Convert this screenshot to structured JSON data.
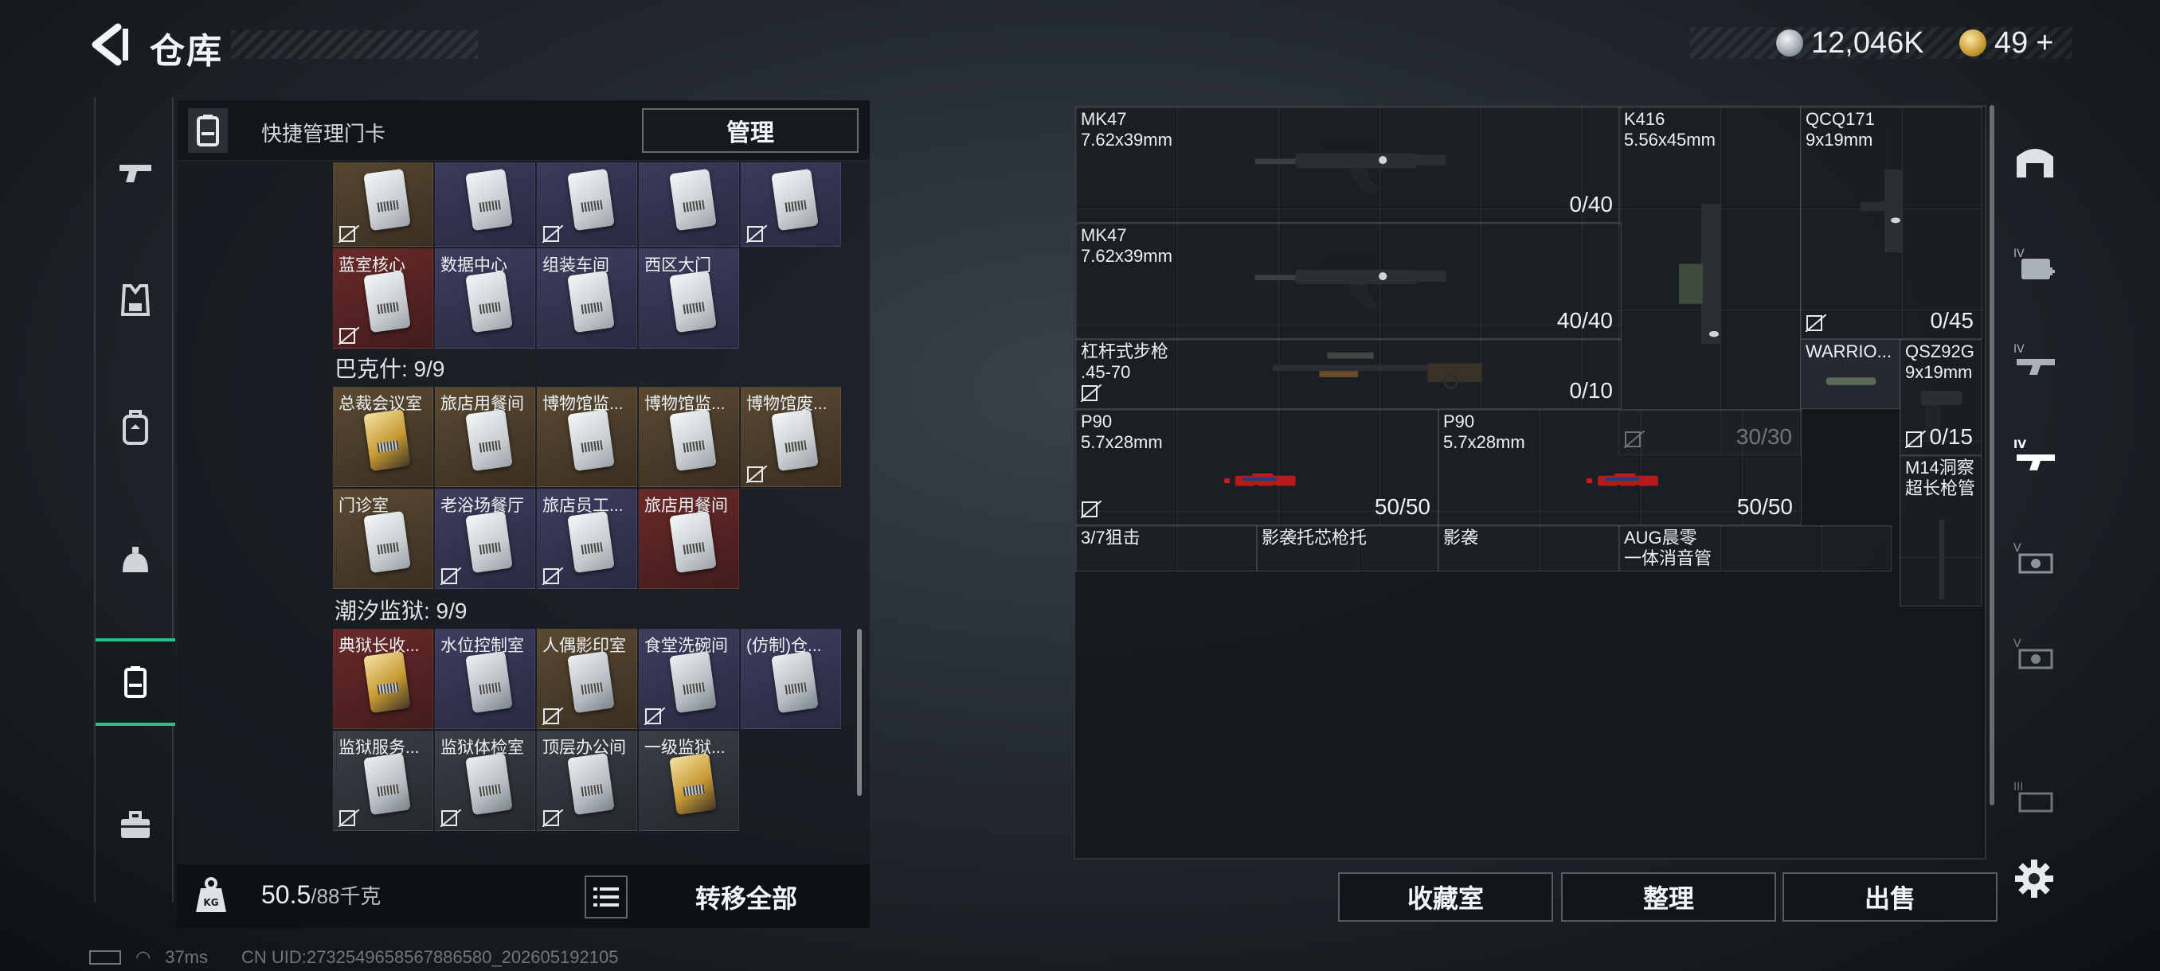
{
  "header": {
    "title": "仓库",
    "silver_amount": "12,046K",
    "gold_amount": "49",
    "gold_plus": "+"
  },
  "left_nav": {
    "items": [
      "firearm-icon",
      "armor-vest-icon",
      "backpack-icon",
      "helmet-bag-icon",
      "keycard-icon",
      "toolbox-icon"
    ],
    "active": "keycard-icon"
  },
  "keycard_panel": {
    "title": "快捷管理门卡",
    "manage_label": "管理",
    "top_row": [
      {
        "label": "",
        "color": "brown",
        "locked": true
      },
      {
        "label": "",
        "color": "purple",
        "locked": false
      },
      {
        "label": "",
        "color": "purple",
        "locked": true
      },
      {
        "label": "",
        "color": "purple",
        "locked": false
      },
      {
        "label": "",
        "color": "purple",
        "locked": true
      }
    ],
    "top_row2": [
      {
        "label": "蓝室核心",
        "color": "red",
        "locked": true
      },
      {
        "label": "数据中心",
        "color": "purple",
        "locked": false
      },
      {
        "label": "组装车间",
        "color": "purple",
        "locked": false
      },
      {
        "label": "西区大门",
        "color": "purple",
        "locked": false
      }
    ],
    "sections": [
      {
        "title": "巴克什: 9/9",
        "cards": [
          {
            "label": "总裁会议室",
            "color": "brown",
            "card": "gold",
            "locked": false
          },
          {
            "label": "旅店用餐间",
            "color": "brown",
            "card": "white",
            "locked": false
          },
          {
            "label": "博物馆监...",
            "color": "brown",
            "card": "white",
            "locked": false
          },
          {
            "label": "博物馆监...",
            "color": "brown",
            "card": "white",
            "locked": false
          },
          {
            "label": "博物馆废...",
            "color": "brown",
            "card": "white",
            "locked": true
          },
          {
            "label": "门诊室",
            "color": "brown",
            "card": "white",
            "locked": false
          },
          {
            "label": "老浴场餐厅",
            "color": "purple",
            "card": "white",
            "locked": true
          },
          {
            "label": "旅店员工...",
            "color": "purple",
            "card": "white",
            "locked": true
          },
          {
            "label": "旅店用餐间",
            "color": "red",
            "card": "white",
            "locked": false
          }
        ]
      },
      {
        "title": "潮汐监狱: 9/9",
        "cards": [
          {
            "label": "典狱长收...",
            "color": "red",
            "card": "gold",
            "locked": false
          },
          {
            "label": "水位控制室",
            "color": "purple",
            "card": "gray",
            "locked": false
          },
          {
            "label": "人偶影印室",
            "color": "brown",
            "card": "gray",
            "locked": true
          },
          {
            "label": "食堂洗碗间",
            "color": "purple",
            "card": "gray",
            "locked": true
          },
          {
            "label": "(仿制)仓...",
            "color": "purple",
            "card": "gray",
            "locked": false
          },
          {
            "label": "监狱服务...",
            "color": "dark",
            "card": "gray",
            "locked": true
          },
          {
            "label": "监狱体检室",
            "color": "dark",
            "card": "gray",
            "locked": true
          },
          {
            "label": "顶层办公间",
            "color": "dark",
            "card": "gray",
            "locked": true
          },
          {
            "label": "一级监狱...",
            "color": "dark",
            "card": "gold",
            "locked": false
          }
        ]
      }
    ]
  },
  "weight": {
    "current": "50.5",
    "capacity": "/88千克"
  },
  "transfer_all_label": "转移全部",
  "footer": {
    "ping": "37ms",
    "uid": "CN UID:2732549658567886580_202605192105"
  },
  "weapons": [
    {
      "name": "MK47\n7.62x39mm",
      "count": "0/40",
      "locked": false
    },
    {
      "name": "K416\n5.56x45mm",
      "count": "30/30",
      "locked": true
    },
    {
      "name": "QCQ171\n9x19mm",
      "count": "0/45",
      "locked": true
    },
    {
      "name": "MK47\n7.62x39mm",
      "count": "40/40",
      "locked": false
    },
    {
      "name": "杠杆式步枪\n.45-70",
      "count": "0/10",
      "locked": true
    },
    {
      "name": "WARRIO...",
      "count": "",
      "locked": false
    },
    {
      "name": "QSZ92G\n9x19mm",
      "count": "0/15",
      "locked": true
    },
    {
      "name": "P90\n5.7x28mm",
      "count": "50/50",
      "locked": true
    },
    {
      "name": "P90\n5.7x28mm",
      "count": "50/50",
      "locked": false
    },
    {
      "name": "M14洞察\n超长枪管",
      "count": "",
      "locked": false
    },
    {
      "name": "3/7狙击",
      "count": "",
      "locked": false
    },
    {
      "name": "影袭托芯枪托",
      "count": "",
      "locked": false
    },
    {
      "name": "影袭",
      "count": "",
      "locked": false
    },
    {
      "name": "AUG晨零\n一体消音管",
      "count": "",
      "locked": false
    }
  ],
  "bottom_buttons": {
    "collection": "收藏室",
    "organize": "整理",
    "sell": "出售"
  },
  "right_nav": {
    "items": [
      "bunker-icon",
      "medkit-iv-icon",
      "armor-iv-icon",
      "weapon-iv-icon",
      "weapon-v-icon",
      "weapon-v2-icon",
      "weapon-iii-icon"
    ]
  },
  "colors": {
    "accent": "#29c08a",
    "card_brown": "#5a4a32",
    "card_purple": "#3e3d5e",
    "card_red": "#6a2a2a"
  }
}
